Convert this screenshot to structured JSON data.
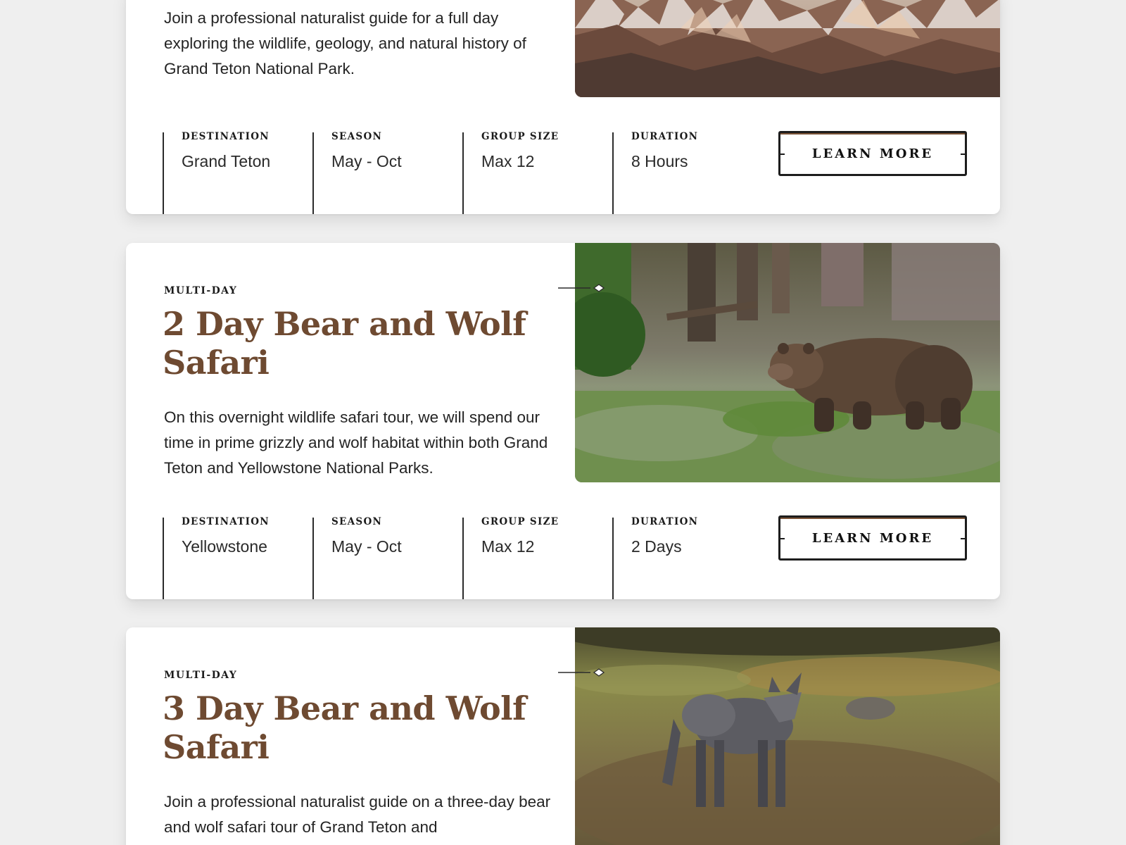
{
  "tours": [
    {
      "category": "",
      "title": "",
      "description": "Join a professional naturalist guide for a full day exploring the wildlife, geology, and natural history of Grand Teton National Park.",
      "image": "mountain-peaks-photo",
      "details": [
        {
          "label": "DESTINATION",
          "value": "Grand Teton"
        },
        {
          "label": "SEASON",
          "value": "May - Oct"
        },
        {
          "label": "GROUP SIZE",
          "value": "Max 12"
        },
        {
          "label": "DURATION",
          "value": "8 Hours"
        }
      ],
      "cta": "LEARN MORE"
    },
    {
      "category": "MULTI-DAY",
      "title": "2 Day Bear and Wolf Safari",
      "description": "On this overnight wildlife safari tour, we will spend our time in prime grizzly and wolf habitat within both Grand Teton and Yellowstone National Parks.",
      "image": "grizzly-bear-photo",
      "details": [
        {
          "label": "DESTINATION",
          "value": "Yellowstone"
        },
        {
          "label": "SEASON",
          "value": "May - Oct"
        },
        {
          "label": "GROUP SIZE",
          "value": "Max 12"
        },
        {
          "label": "DURATION",
          "value": "2 Days"
        }
      ],
      "cta": "LEARN MORE"
    },
    {
      "category": "MULTI-DAY",
      "title": "3 Day Bear and Wolf Safari",
      "description": "Join a professional naturalist guide on a three-day bear and wolf safari tour of Grand Teton and",
      "image": "gray-wolf-photo"
    }
  ],
  "colors": {
    "title_brown": "#6e4a31",
    "page_background": "#efefef",
    "card_background": "#ffffff",
    "button_border": "#1d1d1d"
  },
  "icons": {
    "connector": "diamond-connector-icon"
  }
}
